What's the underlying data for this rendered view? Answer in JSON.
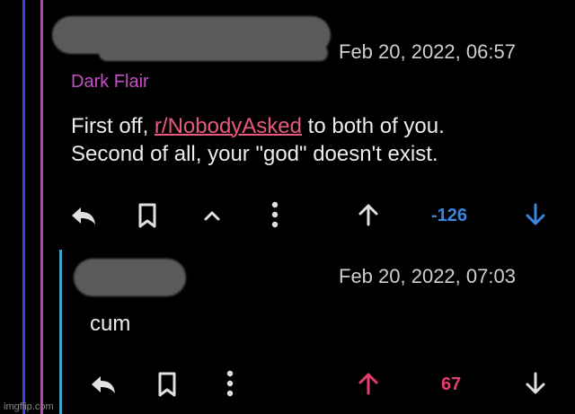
{
  "colors": {
    "background": "#000000",
    "thread_line_1": "#3b45d6",
    "thread_line_2": "#c03bb5",
    "thread_line_3": "#3ea5c2",
    "flair": "#c64ec9",
    "link": "#e8587f",
    "downvoted": "#3a86e0",
    "upvoted": "#e63c6e",
    "icon": "#e0e0e0"
  },
  "comment1": {
    "timestamp": "Feb 20, 2022, 06:57",
    "flair": "Dark Flair",
    "body_prefix": "First off, ",
    "subreddit_link": "r/NobodyAsked",
    "body_line1_suffix": " to both of you.",
    "body_line2": "Second of all, your \"god\" doesn't exist.",
    "score": "-126",
    "vote_state": "downvoted",
    "actions": [
      "reply-icon",
      "bookmark-icon",
      "collapse-icon",
      "more-icon",
      "upvote-icon",
      "downvote-icon"
    ]
  },
  "comment2": {
    "timestamp": "Feb 20, 2022, 07:03",
    "body": "cum",
    "score": "67",
    "vote_state": "upvoted",
    "actions": [
      "reply-icon",
      "bookmark-icon",
      "more-icon",
      "upvote-icon",
      "downvote-icon"
    ]
  },
  "watermark": "imgflip.com"
}
